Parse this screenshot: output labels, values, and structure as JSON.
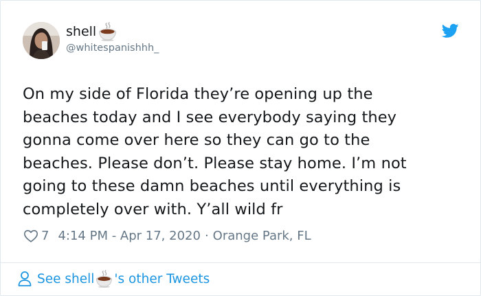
{
  "author": {
    "display_name": "shell",
    "name_emoji": "hot-beverage-emoji",
    "handle": "@whitespanishhh_",
    "avatar": "profile-photo"
  },
  "tweet": {
    "text": "On my side of Florida they’re opening up the\nbeaches today and I see everybody saying they\ngonna come over here so they can go to the\nbeaches. Please don’t. Please stay home. I’m not\ngoing to these damn beaches until everything is\ncompletely over with. Y’all wild fr",
    "likes": "7",
    "time": "4:14 PM - Apr 17, 2020",
    "separator": "·",
    "location": "Orange Park, FL"
  },
  "footer": {
    "prefix": "See shell",
    "suffix": "'s other Tweets"
  },
  "icons": {
    "brand": "twitter-bird-icon",
    "like": "heart-icon",
    "profile": "person-icon"
  },
  "colors": {
    "brand": "#1da1f2",
    "link": "#1b95e0",
    "text": "#14171a",
    "secondary": "#657786",
    "border": "#e1e8ed"
  }
}
